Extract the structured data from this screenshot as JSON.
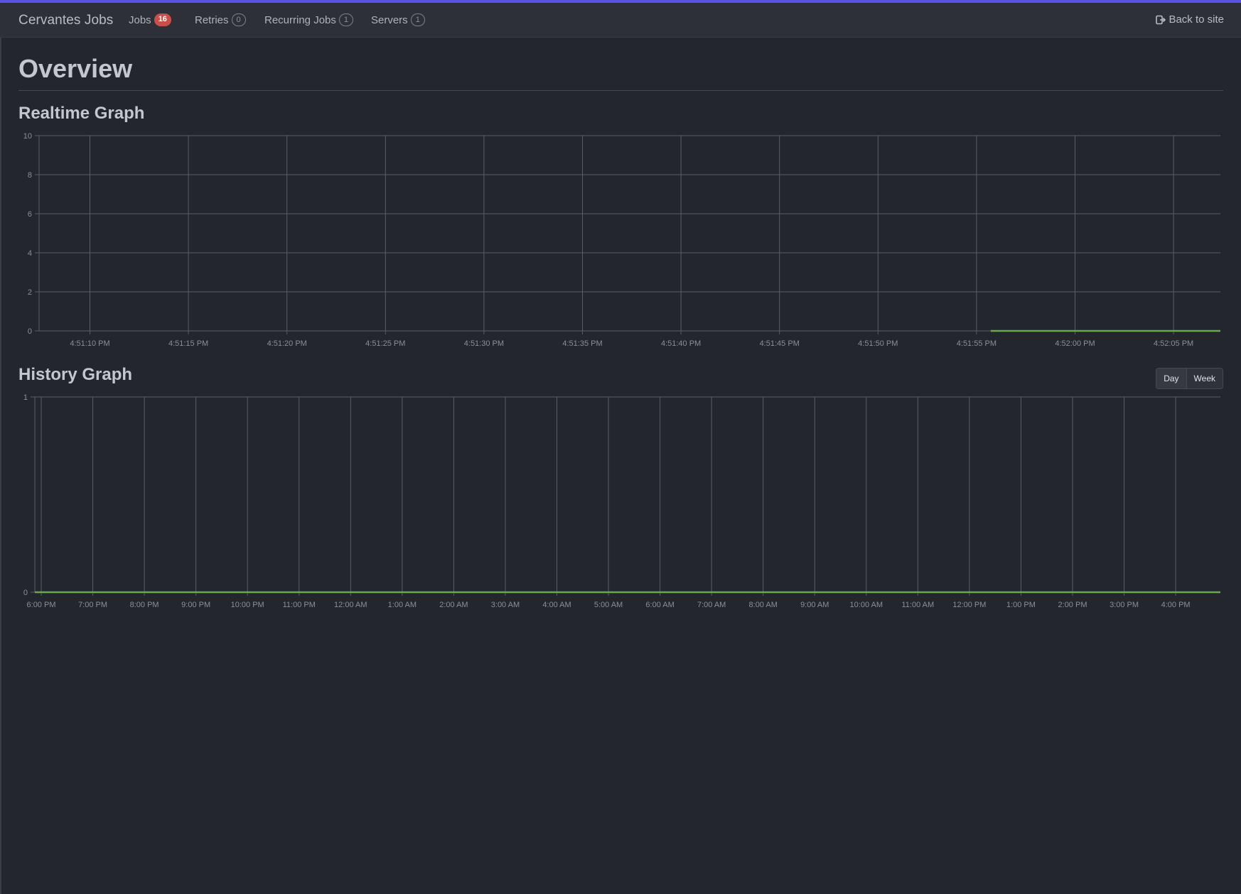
{
  "navbar": {
    "brand": "Cervantes Jobs",
    "items": [
      {
        "label": "Jobs",
        "badge": "16",
        "badge_style": "red"
      },
      {
        "label": "Retries",
        "badge": "0",
        "badge_style": "outline"
      },
      {
        "label": "Recurring Jobs",
        "badge": "1",
        "badge_style": "outline"
      },
      {
        "label": "Servers",
        "badge": "1",
        "badge_style": "outline"
      }
    ],
    "back_label": "Back to site",
    "back_icon": "sign-out-icon"
  },
  "page": {
    "title": "Overview",
    "realtime_title": "Realtime Graph",
    "history_title": "History Graph",
    "range_buttons": [
      "Day",
      "Week"
    ]
  },
  "colors": {
    "accent_bar": "#5a52e0",
    "series_line": "#6aa84f",
    "badge_red": "#c9504a"
  },
  "chart_data": [
    {
      "type": "line",
      "title": "Realtime Graph",
      "x": [
        "4:51:10 PM",
        "4:51:15 PM",
        "4:51:20 PM",
        "4:51:25 PM",
        "4:51:30 PM",
        "4:51:35 PM",
        "4:51:40 PM",
        "4:51:45 PM",
        "4:51:50 PM",
        "4:51:55 PM",
        "4:52:00 PM",
        "4:52:05 PM"
      ],
      "y_ticks": [
        "0",
        "2",
        "4",
        "6",
        "8",
        "10"
      ],
      "ylim": [
        0,
        10
      ],
      "series": [
        {
          "values": [
            null,
            null,
            null,
            null,
            null,
            null,
            null,
            null,
            null,
            0,
            0,
            0
          ],
          "color": "#6aa84f"
        }
      ],
      "grid": true
    },
    {
      "type": "line",
      "title": "History Graph",
      "x": [
        "6:00 PM",
        "7:00 PM",
        "8:00 PM",
        "9:00 PM",
        "10:00 PM",
        "11:00 PM",
        "12:00 AM",
        "1:00 AM",
        "2:00 AM",
        "3:00 AM",
        "4:00 AM",
        "5:00 AM",
        "6:00 AM",
        "7:00 AM",
        "8:00 AM",
        "9:00 AM",
        "10:00 AM",
        "11:00 AM",
        "12:00 PM",
        "1:00 PM",
        "2:00 PM",
        "3:00 PM",
        "4:00 PM"
      ],
      "y_ticks": [
        "0",
        "1"
      ],
      "ylim": [
        0,
        1
      ],
      "series": [
        {
          "values": [
            0,
            0,
            0,
            0,
            0,
            0,
            0,
            0,
            0,
            0,
            0,
            0,
            0,
            0,
            0,
            0,
            0,
            0,
            0,
            0,
            0,
            0,
            0
          ],
          "color": "#6aa84f"
        }
      ],
      "grid": true
    }
  ]
}
